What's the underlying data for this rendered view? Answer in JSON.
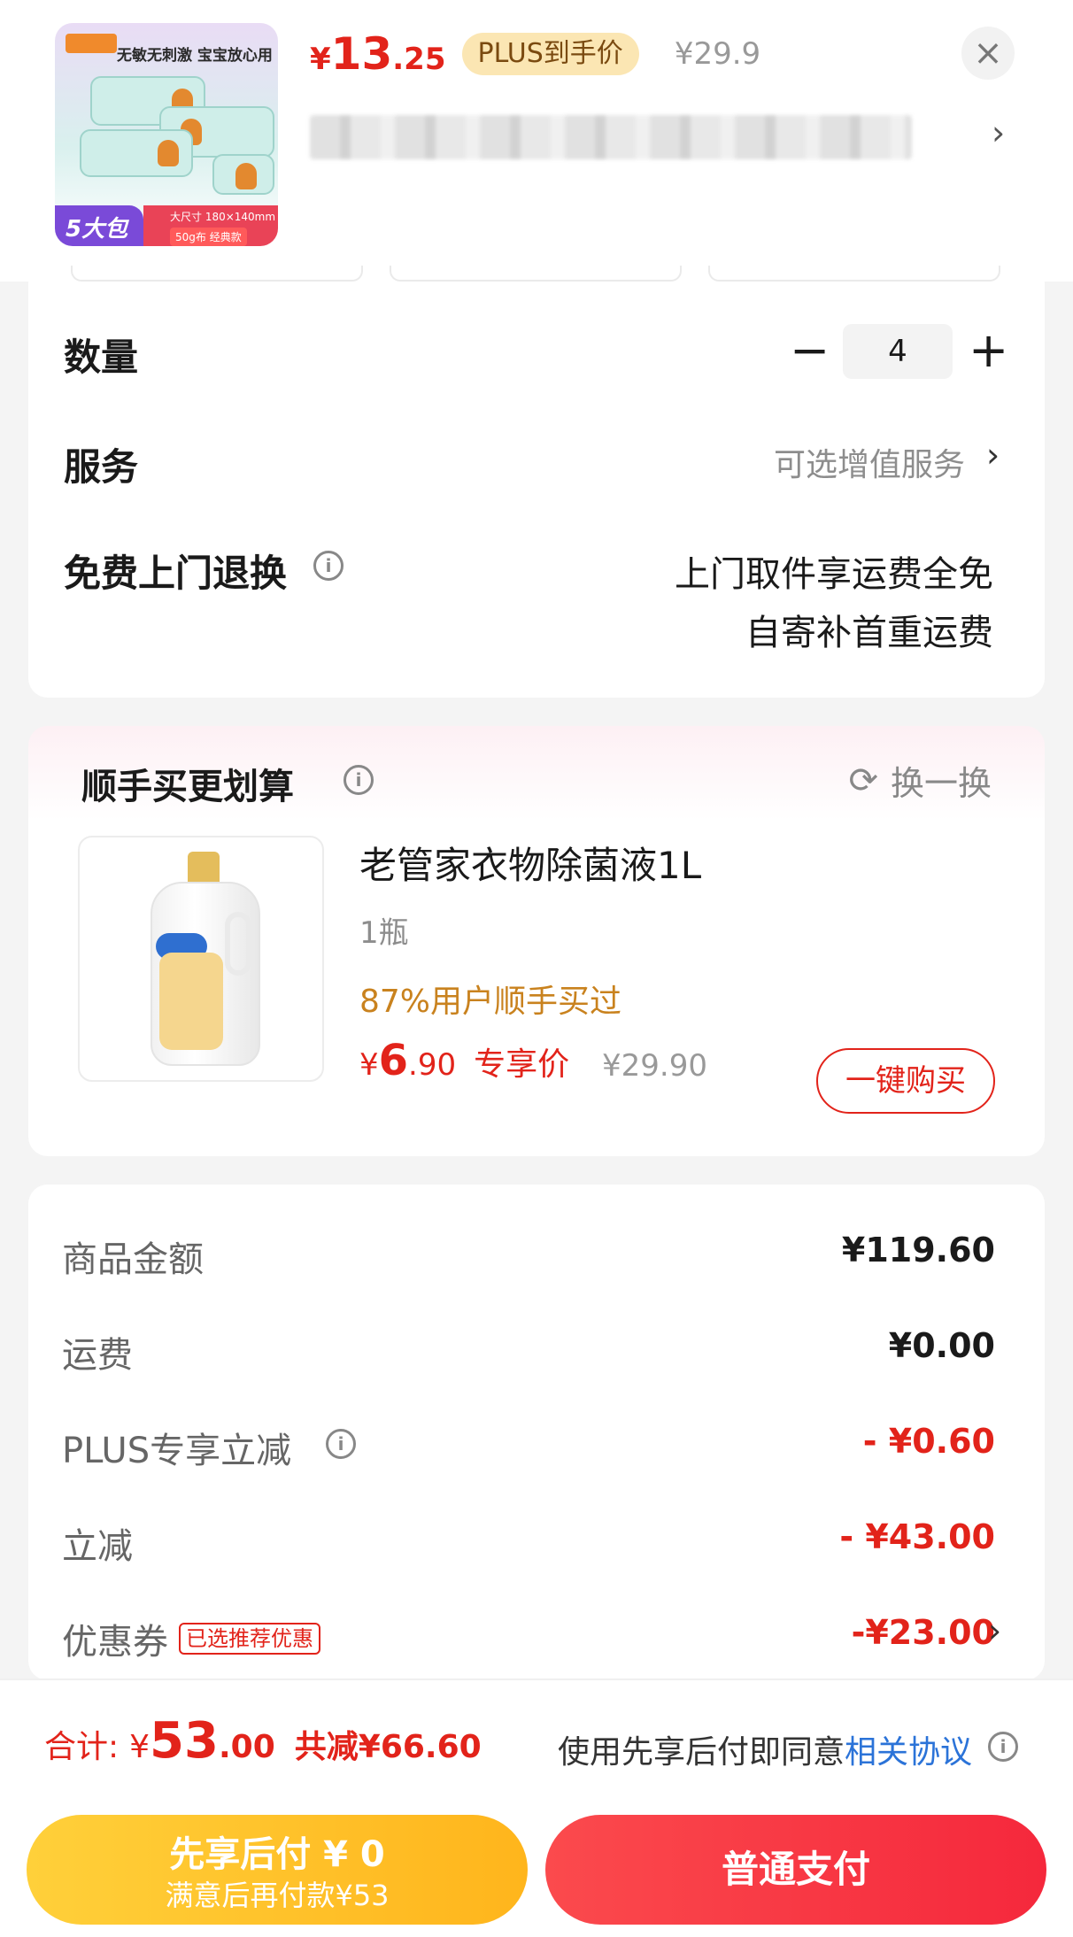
{
  "product": {
    "thumb_slogan": "无敏无刺激 宝宝放心用",
    "thumb_badge": "5大包",
    "thumb_spec_top": "大尺寸 180×140mm",
    "thumb_spec_bottom": "50g布 经典款",
    "price_symbol": "¥",
    "price_int": "13",
    "price_dec": ".25",
    "plus_tag": "PLUS到手价",
    "original_price": "¥29.9",
    "close_glyph": "×",
    "spec_chevron": "›"
  },
  "quantity": {
    "label": "数量",
    "minus": "−",
    "value": "4",
    "plus": "+"
  },
  "service": {
    "label": "服务",
    "hint": "可选增值服务",
    "chevron": "›"
  },
  "free_return": {
    "label": "免费上门退换",
    "line1": "上门取件享运费全免",
    "line2": "自寄补首重运费"
  },
  "recommend": {
    "title": "顺手买更划算",
    "refresh_label": "换一换",
    "refresh_icon": "⟳",
    "item": {
      "name": "老管家衣物除菌液1L",
      "unit": "1瓶",
      "stat": "87%用户顺手买过",
      "price_symbol": "¥",
      "price_int": "6",
      "price_dec": ".90",
      "price_tag": "专享价",
      "original_price": "¥29.90",
      "buy_label": "一键购买"
    }
  },
  "summary": {
    "rows": [
      {
        "label": "商品金额",
        "value": "¥119.60"
      },
      {
        "label": "运费",
        "value": "¥0.00"
      },
      {
        "label": "PLUS专享立减",
        "value": "- ¥0.60"
      },
      {
        "label": "立减",
        "value": "- ¥43.00"
      },
      {
        "label": "优惠券",
        "value": "-¥23.00"
      }
    ],
    "coupon_tag": "已选推荐优惠",
    "chevron": "›"
  },
  "bottom": {
    "total_label": "合计:",
    "total_symbol": "¥",
    "total_int": "53",
    "total_dec": ".00",
    "saved": "共减¥66.60",
    "agree_text": "使用先享后付即同意",
    "agree_link": "相关协议",
    "pay_later_line1": "先享后付 ¥ 0",
    "pay_later_line2": "满意后再付款¥53",
    "pay_normal": "普通支付"
  },
  "info_glyph": "i",
  "colors": {
    "accent_red": "#e2231a",
    "plus_gold_bg": "#fbe6b3",
    "link_blue": "#2b73d8",
    "stat_orange": "#c9821e",
    "pay_later_yellow": "#ffbf2a",
    "pay_normal_red": "#f5283c"
  },
  "icons": {
    "close": "close-icon",
    "info": "info-icon",
    "refresh": "refresh-icon",
    "chevron": "chevron-right-icon"
  }
}
